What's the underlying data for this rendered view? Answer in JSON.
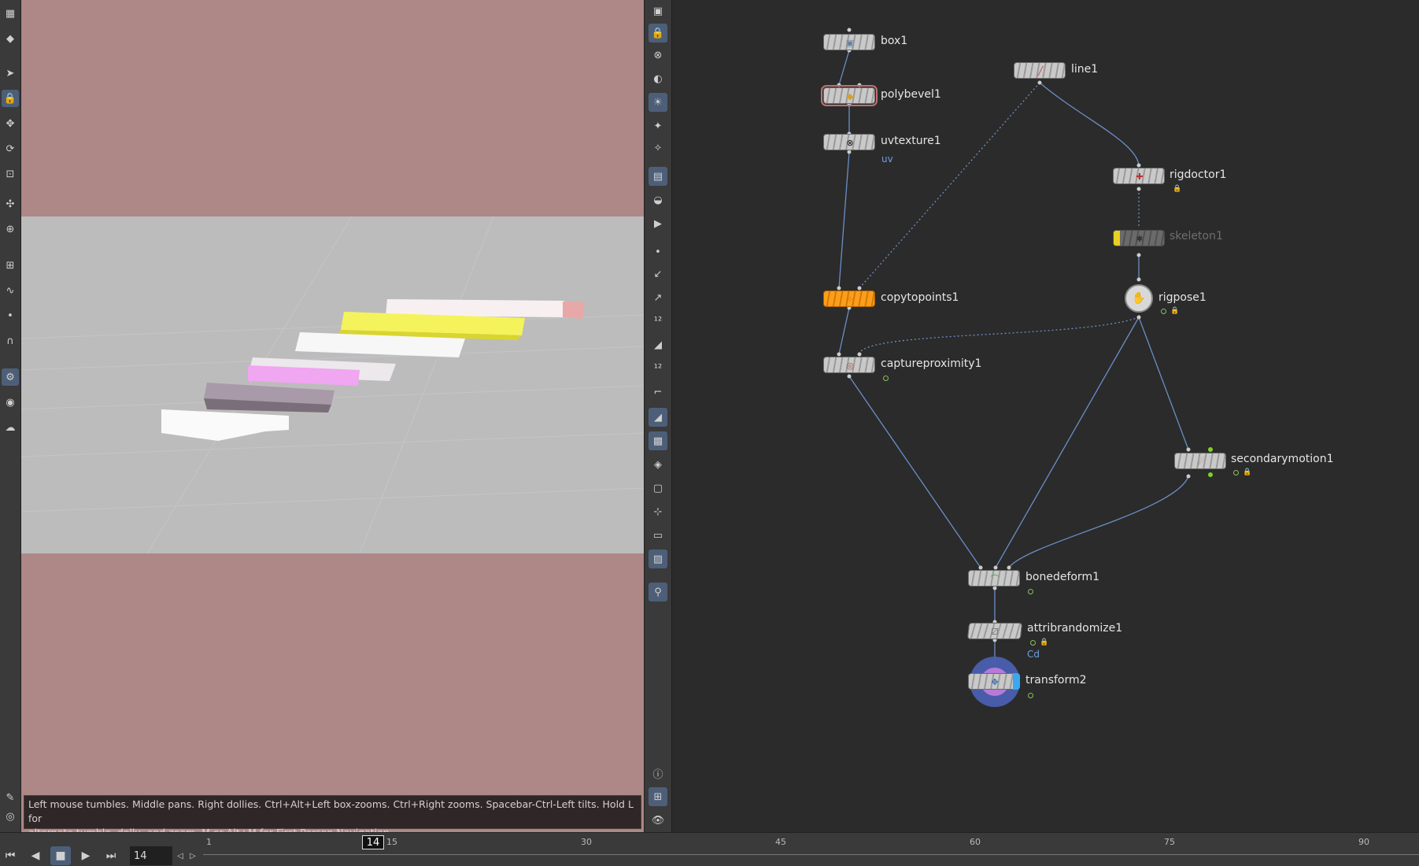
{
  "viewport": {
    "help_line1": "Left mouse tumbles. Middle pans. Right dollies. Ctrl+Alt+Left box-zooms. Ctrl+Right zooms. Spacebar-Ctrl-Left tilts. Hold L for",
    "help_line2": "alternate tumble, dolly, and zoom.     M or Alt+M for First Person Navigation."
  },
  "nodes": {
    "box1": {
      "label": "box1"
    },
    "polybevel1": {
      "label": "polybevel1"
    },
    "uvtexture1": {
      "label": "uvtexture1",
      "sub": "uv"
    },
    "line1": {
      "label": "line1"
    },
    "rigdoctor1": {
      "label": "rigdoctor1"
    },
    "skeleton1": {
      "label": "skeleton1"
    },
    "copytopoints1": {
      "label": "copytopoints1"
    },
    "rigpose1": {
      "label": "rigpose1"
    },
    "captureproximity1": {
      "label": "captureproximity1"
    },
    "secondarymotion1": {
      "label": "secondarymotion1"
    },
    "bonedeform1": {
      "label": "bonedeform1"
    },
    "attribrandomize1": {
      "label": "attribrandomize1",
      "sub": "Cd"
    },
    "transform2": {
      "label": "transform2"
    }
  },
  "timeline": {
    "current_frame": "14",
    "cursor_label": "14",
    "ticks": [
      "1",
      "15",
      "30",
      "45",
      "60",
      "75",
      "90"
    ]
  },
  "colors": {
    "viewport_bg": "#ae8787",
    "floor": "#bcbcbc",
    "selected_node": "#ff9d1a",
    "wire": "#6a8fc7",
    "active_tool": "#4d5f78"
  },
  "icons": {
    "play": "play-icon",
    "stop": "stop-icon",
    "info": "info-icon"
  }
}
